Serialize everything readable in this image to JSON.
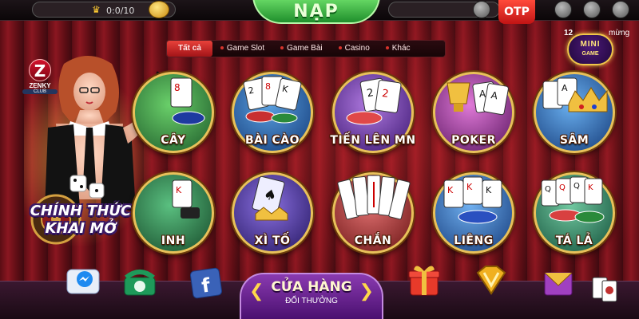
{
  "topbar": {
    "level_count": "0:0/10",
    "nap_label": "NẠP",
    "otp_label": "OTP"
  },
  "logo": {
    "letter": "Z",
    "name": "ZENKY",
    "sub": "CLUB"
  },
  "promo": {
    "line1": "CHÍNH THỨC",
    "line2": "KHAI MỞ"
  },
  "tabs": [
    {
      "label": "Tất cả",
      "active": true
    },
    {
      "label": "Game Slot"
    },
    {
      "label": "Game Bài"
    },
    {
      "label": "Casino"
    },
    {
      "label": "Khác"
    }
  ],
  "mini_game": {
    "badge": "12",
    "title": "MINI",
    "subtitle": "GAME",
    "greeting": "mừng"
  },
  "games": [
    {
      "label": "CÂY",
      "theme": "#2a7a3a"
    },
    {
      "label": "BÀI CÀO",
      "theme": "#1a5aa0"
    },
    {
      "label": "TIẾN LÊN MN",
      "theme": "#5a2a90"
    },
    {
      "label": "POKER",
      "theme": "#8a2a80"
    },
    {
      "label": "SÂM",
      "theme": "#2a6ab0"
    },
    {
      "label": "INH",
      "theme": "#2a7a3a"
    },
    {
      "label": "XÌ TỐ",
      "theme": "#3a2a8a"
    },
    {
      "label": "CHẮN",
      "theme": "#a02a2a"
    },
    {
      "label": "LIÊNG",
      "theme": "#2a60a0"
    },
    {
      "label": "TÁ LẢ",
      "theme": "#2a7a4a"
    }
  ],
  "bottom": {
    "shop_line1": "CỬA HÀNG",
    "shop_line2": "ĐỔI THƯỞNG"
  }
}
